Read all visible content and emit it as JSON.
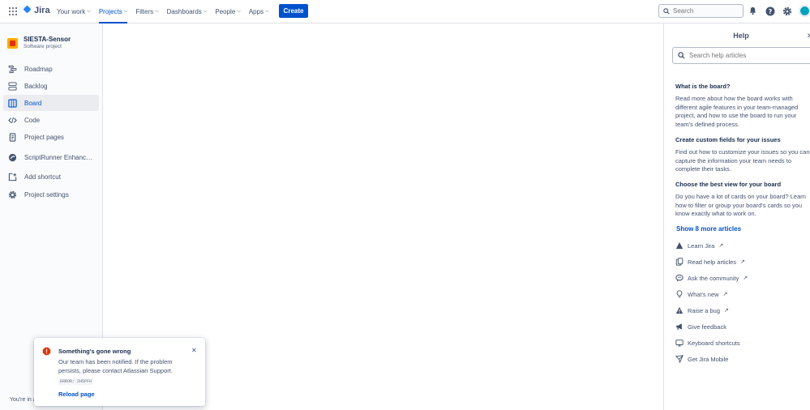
{
  "topbar": {
    "app_name": "Jira",
    "nav": [
      {
        "label": "Your work",
        "active": false
      },
      {
        "label": "Projects",
        "active": true
      },
      {
        "label": "Filters",
        "active": false
      },
      {
        "label": "Dashboards",
        "active": false
      },
      {
        "label": "People",
        "active": false
      },
      {
        "label": "Apps",
        "active": false
      }
    ],
    "create_label": "Create",
    "search_placeholder": "Search",
    "accent": "#0052cc"
  },
  "sidebar": {
    "project_name": "SIESTA-Sensor",
    "project_type": "Software project",
    "items": [
      {
        "label": "Roadmap",
        "icon": "roadmap-icon",
        "active": false
      },
      {
        "label": "Backlog",
        "icon": "backlog-icon",
        "active": false
      },
      {
        "label": "Board",
        "icon": "board-icon",
        "active": true
      },
      {
        "label": "Code",
        "icon": "code-icon",
        "active": false
      },
      {
        "label": "Project pages",
        "icon": "page-icon",
        "active": false
      },
      {
        "label": "ScriptRunner Enhanced...",
        "icon": "scriptrunner-icon",
        "active": false
      },
      {
        "label": "Add shortcut",
        "icon": "add-shortcut-icon",
        "active": false
      },
      {
        "label": "Project settings",
        "icon": "settings-icon",
        "active": false
      }
    ],
    "footer": "You're in a"
  },
  "help": {
    "title": "Help",
    "search_placeholder": "Search help articles",
    "articles": [
      {
        "title": "What is the board?",
        "body": "Read more about how the board works with different agile features in your team-managed project, and how to use the board to run your team's defined process."
      },
      {
        "title": "Create custom fields for your issues",
        "body": "Find out how to customize your issues so you can capture the information your team needs to complete their tasks."
      },
      {
        "title": "Choose the best view for your board",
        "body": "Do you have a lot of cards on your board? Learn how to filter or group your board's cards so you know exactly what to work on."
      }
    ],
    "more_label": "Show 8 more articles",
    "links": [
      {
        "label": "Learn Jira",
        "icon": "jira-icon",
        "external": true
      },
      {
        "label": "Read help articles",
        "icon": "document-icon",
        "external": true
      },
      {
        "label": "Ask the community",
        "icon": "community-icon",
        "external": true
      },
      {
        "label": "What's new",
        "icon": "lightbulb-icon",
        "external": true
      },
      {
        "label": "Raise a bug",
        "icon": "bug-icon",
        "external": true
      },
      {
        "label": "Give feedback",
        "icon": "megaphone-icon",
        "external": false
      },
      {
        "label": "Keyboard shortcuts",
        "icon": "keyboard-icon",
        "external": false
      },
      {
        "label": "Get Jira Mobile",
        "icon": "mobile-icon",
        "external": false
      }
    ]
  },
  "toast": {
    "title": "Something's gone wrong",
    "body": "Our team has been notified. If the problem persists, please contact Atlassian Support.",
    "error_code": "ERROR: 2H5PFH",
    "reload_label": "Reload page",
    "error_color": "#de350b"
  }
}
